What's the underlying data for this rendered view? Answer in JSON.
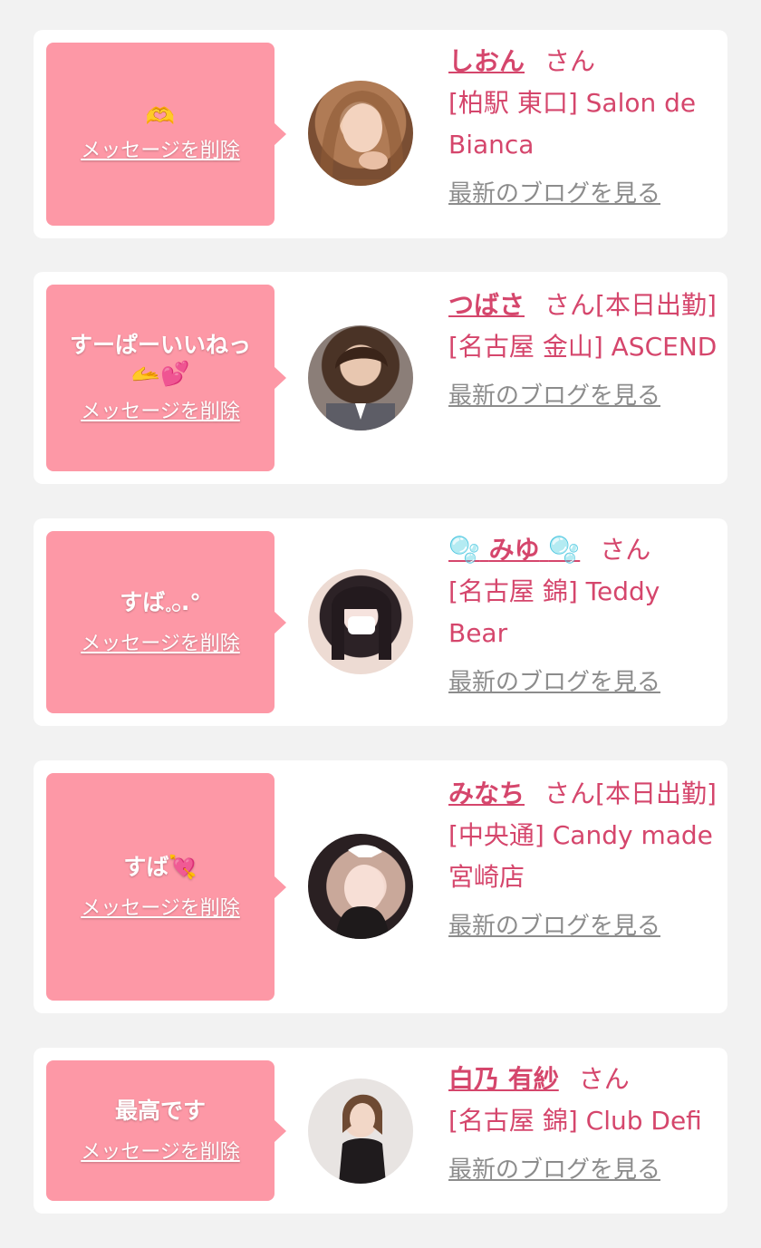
{
  "messages": [
    {
      "message": "",
      "message_icon": "heart-hands-emoji",
      "delete_label": "メッセージを削除",
      "name": "しおん",
      "honorific": "さん",
      "shop": "[柏駅 東口] Salon de Bianca",
      "blog_link": "最新のブログを見る"
    },
    {
      "message": "すーぱーいいねっ",
      "message_icon": "hand-heart-emoji",
      "delete_label": "メッセージを削除",
      "name": "つばさ",
      "honorific": "さん[本日出勤]",
      "shop": "[名古屋 金山] ASCEND",
      "blog_link": "最新のブログを見る"
    },
    {
      "message": "すば𓈒𓂂.°",
      "delete_label": "メッセージを削除",
      "name_prefix_icon": "bubbles-emoji",
      "name": "みゆ",
      "name_suffix_icon": "bubbles-emoji",
      "honorific": "さん",
      "shop": "[名古屋 錦] Teddy Bear",
      "blog_link": "最新のブログを見る"
    },
    {
      "message": "すば💘",
      "delete_label": "メッセージを削除",
      "name": "みなち",
      "honorific": "さん[本日出勤]",
      "shop": "[中央通] Candy made 宮崎店",
      "blog_link": "最新のブログを見る"
    },
    {
      "message": "最高です",
      "delete_label": "メッセージを削除",
      "name": "白乃 有紗",
      "honorific": "さん",
      "shop": "[名古屋 錦] Club Defi",
      "blog_link": "最新のブログを見る"
    }
  ],
  "colors": {
    "page_bg": "#f2f2f2",
    "card_bg": "#ffffff",
    "bubble_bg": "#fd98a6",
    "accent_text": "#d5466c",
    "link_gray": "#8c8c8c"
  }
}
